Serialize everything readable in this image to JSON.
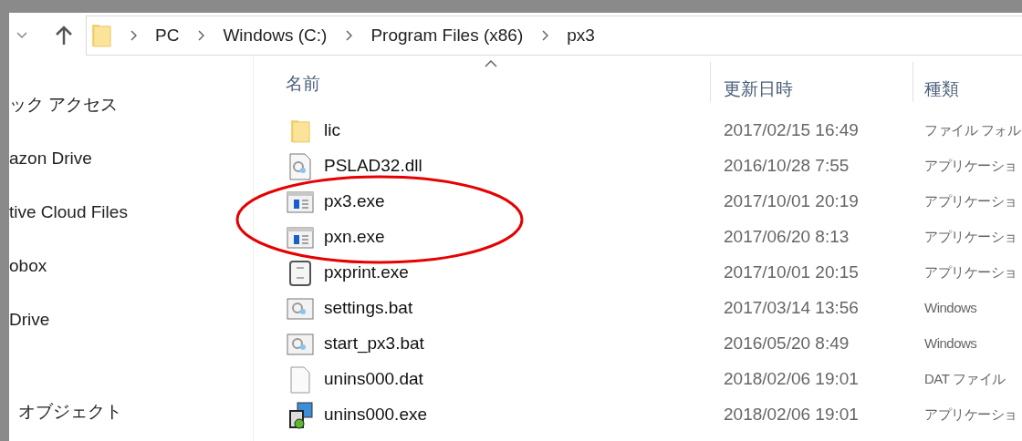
{
  "address_bar": {
    "crumbs": [
      "PC",
      "Windows (C:)",
      "Program Files (x86)",
      "px3"
    ]
  },
  "sidebar": {
    "items": [
      "ック アクセス",
      "azon Drive",
      "tive Cloud Files",
      "obox",
      "Drive",
      "オブジェクト"
    ]
  },
  "columns": [
    "名前",
    "更新日時",
    "種類"
  ],
  "rows": [
    {
      "name": "lic",
      "kind": "folder",
      "modified": "2017/02/15 16:49",
      "type": "ファイル フォル",
      "circled": false
    },
    {
      "name": "PSLAD32.dll",
      "kind": "dll",
      "modified": "2016/10/28 7:55",
      "type": "アプリケーショ",
      "circled": false
    },
    {
      "name": "px3.exe",
      "kind": "exe",
      "modified": "2017/10/01 20:19",
      "type": "アプリケーショ",
      "circled": true
    },
    {
      "name": "pxn.exe",
      "kind": "exe",
      "modified": "2017/06/20 8:13",
      "type": "アプリケーショ",
      "circled": true
    },
    {
      "name": "pxprint.exe",
      "kind": "print",
      "modified": "2017/10/01 20:15",
      "type": "アプリケーショ",
      "circled": false
    },
    {
      "name": "settings.bat",
      "kind": "bat",
      "modified": "2017/03/14 13:56",
      "type": "Windows",
      "circled": false
    },
    {
      "name": "start_px3.bat",
      "kind": "bat",
      "modified": "2016/05/20 8:49",
      "type": "Windows",
      "circled": false
    },
    {
      "name": "unins000.dat",
      "kind": "file",
      "modified": "2018/02/06 19:01",
      "type": "DAT ファイル",
      "circled": false
    },
    {
      "name": "unins000.exe",
      "kind": "installer",
      "modified": "2018/02/06 19:01",
      "type": "アプリケーショ",
      "circled": false
    }
  ]
}
